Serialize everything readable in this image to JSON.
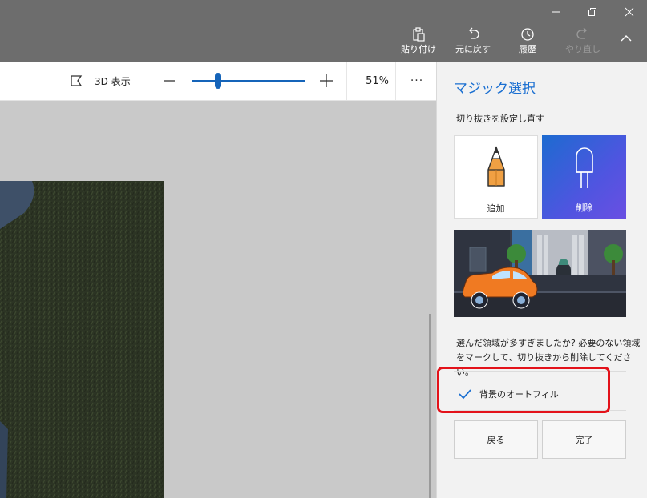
{
  "window_controls": {
    "minimize_icon": "minimize-icon",
    "restore_icon": "restore-icon",
    "close_icon": "close-icon"
  },
  "commands": {
    "paste": {
      "label": "貼り付け",
      "icon": "paste-icon"
    },
    "undo": {
      "label": "元に戻す",
      "icon": "undo-icon"
    },
    "history": {
      "label": "履歴",
      "icon": "history-icon"
    },
    "redo": {
      "label": "やり直し",
      "icon": "redo-icon",
      "disabled": true
    },
    "collapse_icon": "chevron-up-icon"
  },
  "toolbar": {
    "view3d_label": "3D 表示",
    "zoom_value": "51%",
    "zoom_level": 0.2,
    "more": "···"
  },
  "panel": {
    "title": "マジック選択",
    "subtitle": "切り抜きを設定し直す",
    "add_label": "追加",
    "remove_label": "削除",
    "hint": "選んだ領域が多すぎましたか? 必要のない領域をマークして、切り抜きから削除してください。",
    "autofill_label": "背景のオートフィル",
    "autofill_checked": true,
    "back_label": "戻る",
    "done_label": "完了"
  },
  "colors": {
    "accent": "#1a6fd1",
    "title_bar": "#6d6d6d",
    "highlight": "#e3121a"
  }
}
